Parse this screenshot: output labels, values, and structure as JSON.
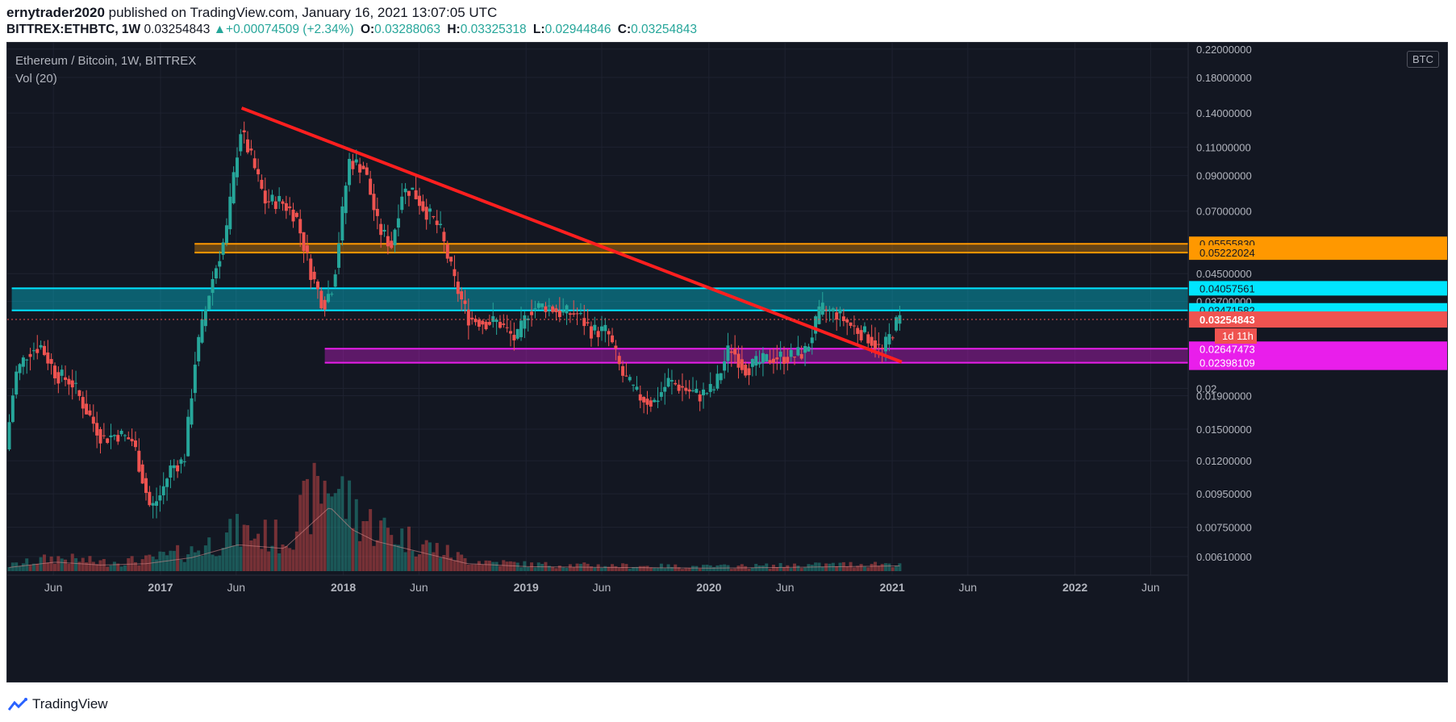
{
  "header": {
    "author": "ernytrader2020",
    "published_text": " published on TradingView.com, January 16, 2021 13:07:05 UTC",
    "symbol": "BITTREX:ETHBTC, 1W",
    "last": "0.03254843",
    "change": "+0.00074509 (+2.34%)",
    "o_label": "O:",
    "o": "0.03288063",
    "h_label": "H:",
    "h": "0.03325318",
    "l_label": "L:",
    "l": "0.02944846",
    "c_label": "C:",
    "c": "0.03254843"
  },
  "legend": {
    "title": "Ethereum / Bitcoin, 1W, BITTREX",
    "volume": "Vol (20)",
    "currency_button": "BTC"
  },
  "footer": {
    "brand": "TradingView"
  },
  "colors": {
    "background": "#131722",
    "up": "#26a69a",
    "down": "#ef5350",
    "trendline": "#ff1f1f",
    "orange_zone": "#ff9800",
    "cyan_zone": "#00e5ff",
    "magenta_zone": "#e91eeb"
  },
  "chart_data": {
    "type": "candlestick",
    "y_scale": "log",
    "ylim": [
      0.0055,
      0.23
    ],
    "y_ticks": [
      "0.22000000",
      "0.18000000",
      "0.14000000",
      "0.11000000",
      "0.09000000",
      "0.07000000",
      "0.04500000",
      "0.03700000",
      "0.02",
      "0.01900000",
      "0.01500000",
      "0.01200000",
      "0.00950000",
      "0.00750000",
      "0.00610000"
    ],
    "y_tick_values": [
      0.22,
      0.18,
      0.14,
      0.11,
      0.09,
      0.07,
      0.045,
      0.037,
      0.02,
      0.019,
      0.015,
      0.012,
      0.0095,
      0.0075,
      0.0061
    ],
    "x_ticks": [
      "Jun",
      "2017",
      "Jun",
      "2018",
      "Jun",
      "2019",
      "Jun",
      "2020",
      "Jun",
      "2021",
      "Jun",
      "2022",
      "Jun"
    ],
    "x_tick_dates": [
      "2016-06-01",
      "2017-01-01",
      "2017-06-01",
      "2018-01-01",
      "2018-06-01",
      "2019-01-01",
      "2019-06-01",
      "2020-01-01",
      "2020-06-01",
      "2021-01-01",
      "2021-06-01",
      "2022-01-01",
      "2022-06-01"
    ],
    "x_range": [
      "2016-03-01",
      "2022-08-15"
    ],
    "price_path": [
      [
        "2016-03-01",
        0.013
      ],
      [
        "2016-03-20",
        0.022
      ],
      [
        "2016-04-15",
        0.026
      ],
      [
        "2016-05-10",
        0.027
      ],
      [
        "2016-06-10",
        0.022
      ],
      [
        "2016-07-10",
        0.021
      ],
      [
        "2016-08-10",
        0.017
      ],
      [
        "2016-09-10",
        0.014
      ],
      [
        "2016-10-10",
        0.0145
      ],
      [
        "2016-11-10",
        0.0138
      ],
      [
        "2016-12-15",
        0.0085
      ],
      [
        "2017-01-05",
        0.0095
      ],
      [
        "2017-01-25",
        0.0115
      ],
      [
        "2017-02-20",
        0.012
      ],
      [
        "2017-03-15",
        0.025
      ],
      [
        "2017-04-15",
        0.042
      ],
      [
        "2017-05-15",
        0.06
      ],
      [
        "2017-06-12",
        0.125
      ],
      [
        "2017-07-01",
        0.105
      ],
      [
        "2017-08-01",
        0.075
      ],
      [
        "2017-09-01",
        0.075
      ],
      [
        "2017-10-01",
        0.068
      ],
      [
        "2017-11-01",
        0.045
      ],
      [
        "2017-11-25",
        0.036
      ],
      [
        "2017-12-15",
        0.042
      ],
      [
        "2018-01-05",
        0.075
      ],
      [
        "2018-01-15",
        0.1
      ],
      [
        "2018-02-15",
        0.095
      ],
      [
        "2018-03-15",
        0.062
      ],
      [
        "2018-04-10",
        0.055
      ],
      [
        "2018-05-01",
        0.08
      ],
      [
        "2018-05-20",
        0.082
      ],
      [
        "2018-06-15",
        0.071
      ],
      [
        "2018-07-15",
        0.062
      ],
      [
        "2018-08-15",
        0.042
      ],
      [
        "2018-09-10",
        0.033
      ],
      [
        "2018-10-10",
        0.032
      ],
      [
        "2018-11-10",
        0.032
      ],
      [
        "2018-12-15",
        0.028
      ],
      [
        "2019-01-10",
        0.035
      ],
      [
        "2019-02-15",
        0.036
      ],
      [
        "2019-03-15",
        0.034
      ],
      [
        "2019-04-15",
        0.034
      ],
      [
        "2019-05-15",
        0.03
      ],
      [
        "2019-06-15",
        0.03
      ],
      [
        "2019-07-15",
        0.022
      ],
      [
        "2019-08-15",
        0.019
      ],
      [
        "2019-09-15",
        0.018
      ],
      [
        "2019-10-15",
        0.021
      ],
      [
        "2019-11-15",
        0.02
      ],
      [
        "2019-12-15",
        0.019
      ],
      [
        "2020-01-15",
        0.02
      ],
      [
        "2020-02-15",
        0.027
      ],
      [
        "2020-03-15",
        0.023
      ],
      [
        "2020-04-15",
        0.024
      ],
      [
        "2020-05-15",
        0.025
      ],
      [
        "2020-06-15",
        0.025
      ],
      [
        "2020-07-15",
        0.026
      ],
      [
        "2020-08-15",
        0.035
      ],
      [
        "2020-09-15",
        0.034
      ],
      [
        "2020-10-15",
        0.031
      ],
      [
        "2020-11-15",
        0.029
      ],
      [
        "2020-12-15",
        0.026
      ],
      [
        "2021-01-16",
        0.0325
      ]
    ],
    "volume_profile": [
      [
        "2016-03-01",
        0.05
      ],
      [
        "2016-06-01",
        0.12
      ],
      [
        "2016-09-01",
        0.08
      ],
      [
        "2016-12-01",
        0.1
      ],
      [
        "2017-03-01",
        0.18
      ],
      [
        "2017-06-01",
        0.35
      ],
      [
        "2017-09-01",
        0.3
      ],
      [
        "2017-12-01",
        0.85
      ],
      [
        "2018-01-15",
        0.55
      ],
      [
        "2018-03-01",
        0.4
      ],
      [
        "2018-06-01",
        0.25
      ],
      [
        "2018-09-01",
        0.1
      ],
      [
        "2019-01-01",
        0.06
      ],
      [
        "2019-06-01",
        0.05
      ],
      [
        "2020-01-01",
        0.04
      ],
      [
        "2020-06-01",
        0.05
      ],
      [
        "2021-01-16",
        0.07
      ]
    ],
    "trendline": {
      "from": [
        "2017-06-12",
        0.145
      ],
      "to": [
        "2021-01-20",
        0.0241
      ]
    },
    "zones": [
      {
        "name": "orange",
        "top": 0.0555583,
        "bottom": 0.05222024,
        "from": "2017-03-10",
        "top_label": "0.05555830",
        "bottom_label": "0.05222024"
      },
      {
        "name": "cyan",
        "top": 0.04057561,
        "bottom": 0.03471582,
        "from": "2016-03-10",
        "top_label": "0.04057561",
        "bottom_label": "0.03471582"
      },
      {
        "name": "magenta",
        "top": 0.02647473,
        "bottom": 0.02398109,
        "from": "2017-11-25",
        "top_label": "0.02647473",
        "bottom_label": "0.02398109"
      }
    ],
    "last_price": {
      "value": 0.03254843,
      "label": "0.03254843",
      "countdown": "1d 11h"
    }
  }
}
